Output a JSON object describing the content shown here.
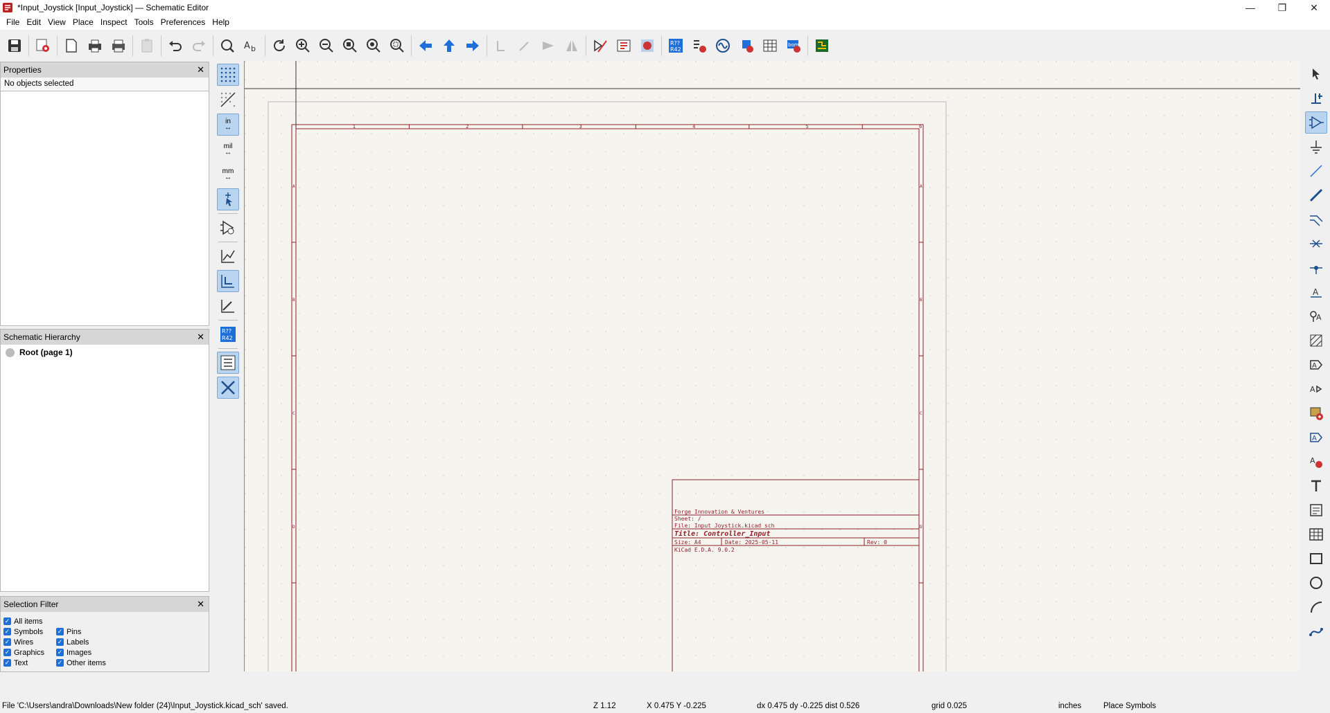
{
  "window": {
    "title": "*Input_Joystick [Input_Joystick] — Schematic Editor",
    "minimize": "—",
    "restore": "❐",
    "close": "✕"
  },
  "menu": [
    "File",
    "Edit",
    "View",
    "Place",
    "Inspect",
    "Tools",
    "Preferences",
    "Help"
  ],
  "properties": {
    "header": "Properties",
    "close": "✕",
    "status": "No objects selected"
  },
  "hierarchy": {
    "header": "Schematic Hierarchy",
    "close": "✕",
    "root": "Root (page 1)"
  },
  "selection_filter": {
    "header": "Selection Filter",
    "close": "✕",
    "items": [
      {
        "label": "All items",
        "checked": true
      },
      {
        "label": "Symbols",
        "checked": true
      },
      {
        "label": "Pins",
        "checked": true
      },
      {
        "label": "Wires",
        "checked": true
      },
      {
        "label": "Labels",
        "checked": true
      },
      {
        "label": "Graphics",
        "checked": true
      },
      {
        "label": "Images",
        "checked": true
      },
      {
        "label": "Text",
        "checked": true
      },
      {
        "label": "Other items",
        "checked": true
      }
    ]
  },
  "left_tools": {
    "unit_in": "in",
    "unit_mil": "mil",
    "unit_mm": "mm"
  },
  "sheet": {
    "col_numbers": [
      "1",
      "2",
      "3",
      "4",
      "5",
      "6"
    ],
    "row_letters": [
      "A",
      "B",
      "C",
      "D"
    ],
    "company": "Forge Innovation & Ventures",
    "sheet": "Sheet: /",
    "file": "File: Input_Joystick.kicad_sch",
    "title": "Title: Controller_Input",
    "size": "Size: A4",
    "date": "Date: 2025-05-11",
    "rev": "Rev: 0",
    "kicad": "KiCad E.D.A. 9.0.2"
  },
  "status": {
    "message": "File 'C:\\Users\\andra\\Downloads\\New folder (24)\\Input_Joystick.kicad_sch' saved.",
    "zoom": "Z 1.12",
    "xy": "X 0.475  Y -0.225",
    "delta": "dx 0.475  dy -0.225  dist 0.526",
    "grid": "grid 0.025",
    "units": "inches",
    "mode": "Place Symbols"
  }
}
